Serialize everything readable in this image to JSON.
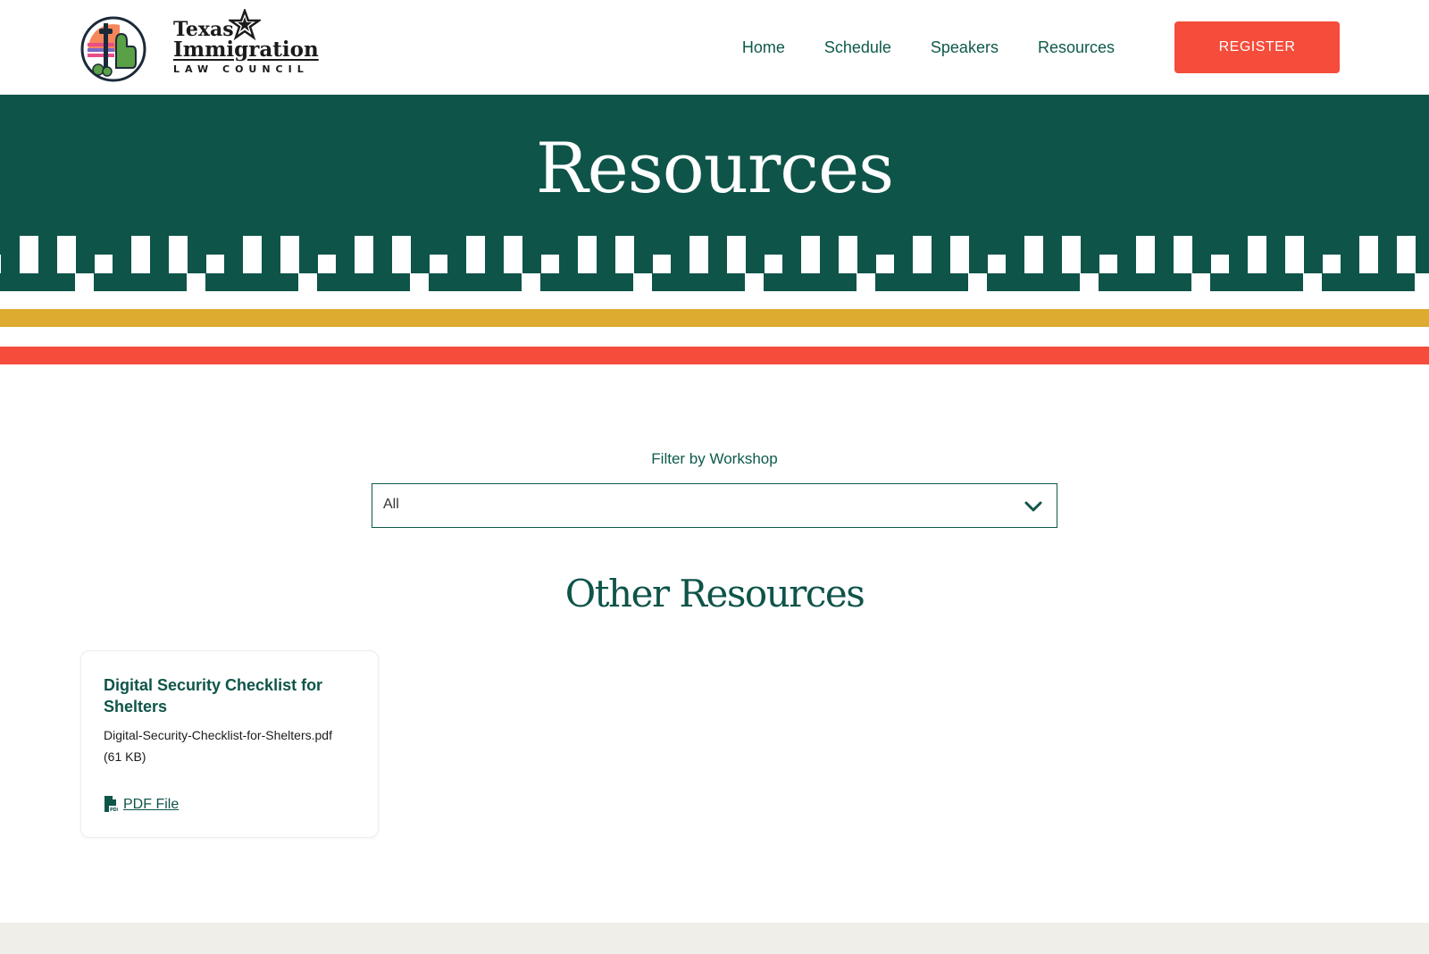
{
  "header": {
    "logo": {
      "line1": "Texas",
      "line2": "Immigration",
      "line3": "LAW COUNCIL"
    },
    "nav": [
      {
        "label": "Home"
      },
      {
        "label": "Schedule"
      },
      {
        "label": "Speakers"
      },
      {
        "label": "Resources"
      }
    ],
    "register_label": "REGISTER"
  },
  "hero": {
    "title": "Resources"
  },
  "filter": {
    "label": "Filter by Workshop",
    "selected": "All"
  },
  "section": {
    "title": "Other Resources"
  },
  "resources": [
    {
      "title": "Digital Security Checklist for Shelters",
      "file": "Digital-Security-Checklist-for-Shelters.pdf (61 KB)",
      "type": "PDF File",
      "icon": "pdf-file-icon"
    }
  ],
  "colors": {
    "brand_green": "#0e5449",
    "accent_red": "#f54c3b",
    "accent_gold": "#dcab2f",
    "footer_bg": "#efeee8"
  }
}
